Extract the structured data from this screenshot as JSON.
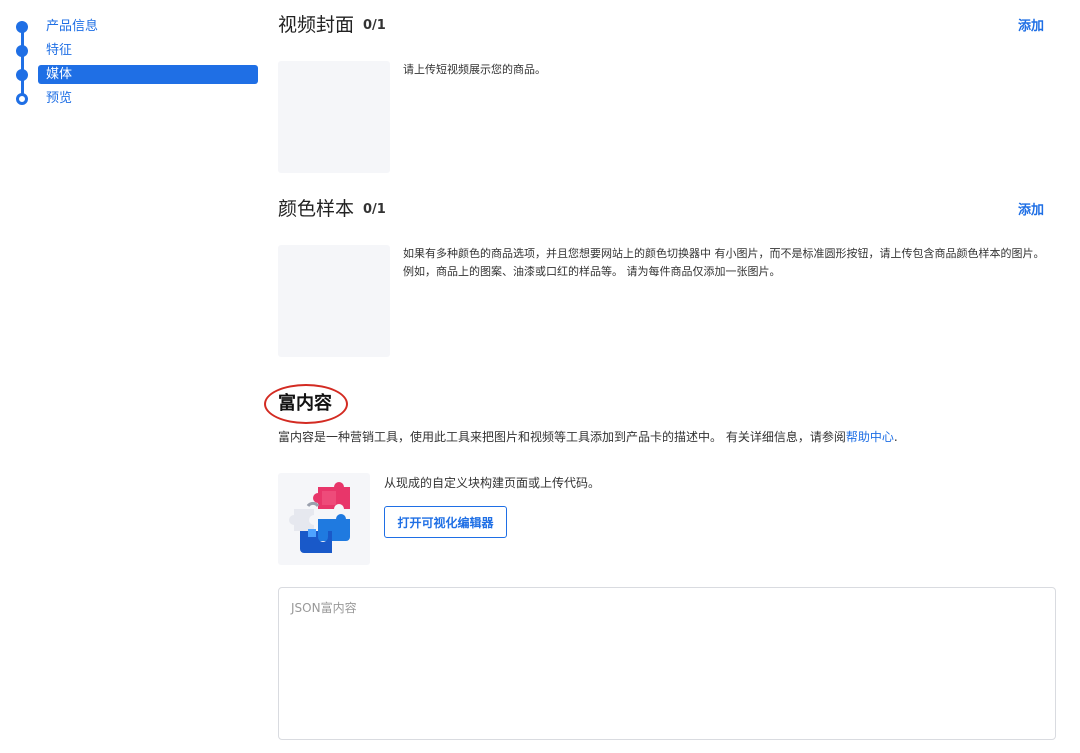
{
  "stepper": {
    "steps": [
      {
        "label": "产品信息"
      },
      {
        "label": "特征"
      },
      {
        "label": "媒体"
      },
      {
        "label": "预览"
      }
    ],
    "active_index": 2,
    "accent_color": "#1f6fe5"
  },
  "video_cover": {
    "title": "视频封面",
    "count": "0/1",
    "add_label": "添加",
    "description": "请上传短视频展示您的商品。"
  },
  "color_swatch": {
    "title": "颜色样本",
    "count": "0/1",
    "add_label": "添加",
    "description": "如果有多种颜色的商品选项，并且您想要网站上的颜色切换器中 有小图片，而不是标准圆形按钮，请上传包含商品颜色样本的图片。 例如，商品上的图案、油漆或口红的样品等。 请为每件商品仅添加一张图片。"
  },
  "rich_content": {
    "title": "富内容",
    "description": "富内容是一种营销工具，使用此工具来把图片和视频等工具添加到产品卡的描述中。 有关详细信息，请参阅",
    "help_link": "帮助中心",
    "help_suffix": ".",
    "editor_text": "从现成的自定义块构建页面或上传代码。",
    "editor_button": "打开可视化编辑器",
    "json_placeholder": "JSON富内容",
    "icon": "puzzle-icon",
    "highlight_color": "#d32b22"
  }
}
